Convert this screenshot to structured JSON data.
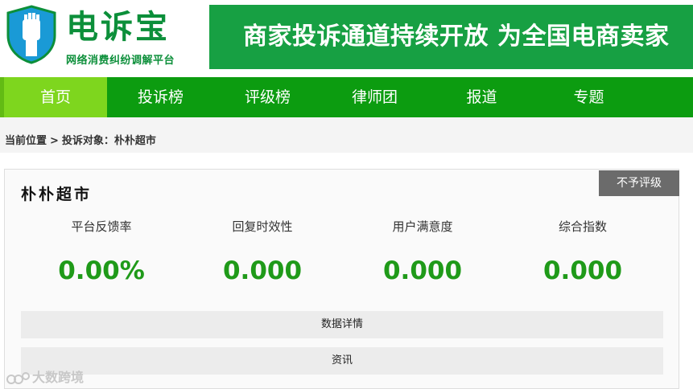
{
  "header": {
    "logo_title": "电诉宝",
    "logo_subtitle": "网络消费纠纷调解平台",
    "banner_text": "商家投诉通道持续开放  为全国电商卖家"
  },
  "nav": {
    "items": [
      {
        "label": "首页"
      },
      {
        "label": "投诉榜"
      },
      {
        "label": "评级榜"
      },
      {
        "label": "律师团"
      },
      {
        "label": "报道"
      },
      {
        "label": "专题"
      }
    ]
  },
  "breadcrumb": {
    "current_position": "当前位置",
    "separator": ">",
    "target": "投诉对象：朴朴超市"
  },
  "card": {
    "title": "朴朴超市",
    "rating_badge": "不予评级",
    "metrics": [
      {
        "label": "平台反馈率",
        "value": "0.00%"
      },
      {
        "label": "回复时效性",
        "value": "0.000"
      },
      {
        "label": "用户满意度",
        "value": "0.000"
      },
      {
        "label": "综合指数",
        "value": "0.000"
      }
    ],
    "data_details_label": "数据详情",
    "news_label": "资讯"
  },
  "watermark": {
    "text": "大数跨境"
  },
  "colors": {
    "brand_green": "#0c9c10",
    "active_nav": "#7ed61e",
    "metric_green": "#1f9a19",
    "badge_gray": "#6b6b6b"
  }
}
